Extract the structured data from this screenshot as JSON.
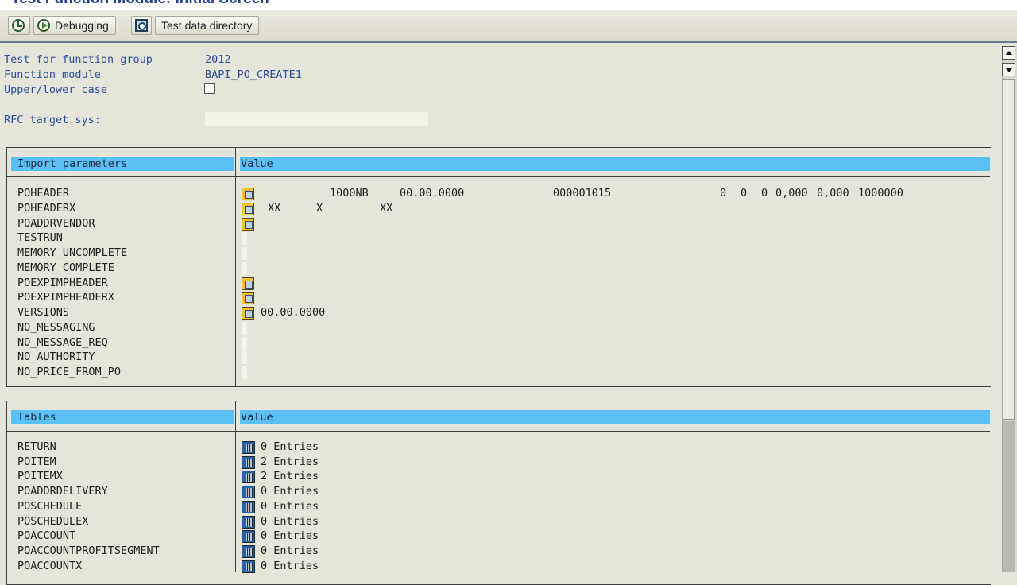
{
  "window": {
    "title": "Test Function Module: Initial Screen"
  },
  "toolbar": {
    "debugging_label": "Debugging",
    "test_data_label": "Test data directory"
  },
  "header": {
    "function_group_label": "Test for function group",
    "function_group_value": "2012",
    "function_module_label": "Function module",
    "function_module_value": "BAPI_PO_CREATE1",
    "case_label": "Upper/lower case",
    "case_checked": false,
    "rfc_label": "RFC target sys:",
    "rfc_value": ""
  },
  "import_section": {
    "col1": "Import parameters",
    "col2": "Value",
    "rows": [
      {
        "name": "POHEADER",
        "icon": "structure-icon",
        "v1": "1000NB",
        "v2": "00.00.0000",
        "v3": "000001015",
        "v4": "0",
        "v5": "0",
        "v6": "0",
        "v7": "0,000",
        "v8": "0,000",
        "v9": "1000000"
      },
      {
        "name": "POHEADERX",
        "icon": "structure-icon",
        "v1": "XX",
        "v2": "X",
        "v3": "XX"
      },
      {
        "name": "POADDRVENDOR",
        "icon": "structure-icon"
      },
      {
        "name": "TESTRUN",
        "icon": "none"
      },
      {
        "name": "MEMORY_UNCOMPLETE",
        "icon": "none"
      },
      {
        "name": "MEMORY_COMPLETE",
        "icon": "none"
      },
      {
        "name": "POEXPIMPHEADER",
        "icon": "structure-icon"
      },
      {
        "name": "POEXPIMPHEADERX",
        "icon": "structure-icon"
      },
      {
        "name": "VERSIONS",
        "icon": "structure-icon",
        "v1": "00.00.0000"
      },
      {
        "name": "NO_MESSAGING",
        "icon": "none"
      },
      {
        "name": "NO_MESSAGE_REQ",
        "icon": "none"
      },
      {
        "name": "NO_AUTHORITY",
        "icon": "none"
      },
      {
        "name": "NO_PRICE_FROM_PO",
        "icon": "none"
      }
    ]
  },
  "tables_section": {
    "col1": "Tables",
    "col2": "Value",
    "rows": [
      {
        "name": "RETURN",
        "value": "0 Entries"
      },
      {
        "name": "POITEM",
        "value": "2 Entries"
      },
      {
        "name": "POITEMX",
        "value": "2 Entries"
      },
      {
        "name": "POADDRDELIVERY",
        "value": "0 Entries"
      },
      {
        "name": "POSCHEDULE",
        "value": "0 Entries"
      },
      {
        "name": "POSCHEDULEX",
        "value": "0 Entries"
      },
      {
        "name": "POACCOUNT",
        "value": "0 Entries"
      },
      {
        "name": "POACCOUNTPROFITSEGMENT",
        "value": "0 Entries"
      },
      {
        "name": "POACCOUNTX",
        "value": "0 Entries"
      }
    ]
  },
  "icons": {
    "execute": "clock-execute-icon",
    "debug": "debug-run-icon",
    "find": "magnifier-icon",
    "structure": "structure-edit-icon",
    "table": "table-entries-icon"
  },
  "colors": {
    "section_header": "#5bc0f4",
    "label_blue": "#2c4f9a",
    "background": "#e6e5d9"
  }
}
